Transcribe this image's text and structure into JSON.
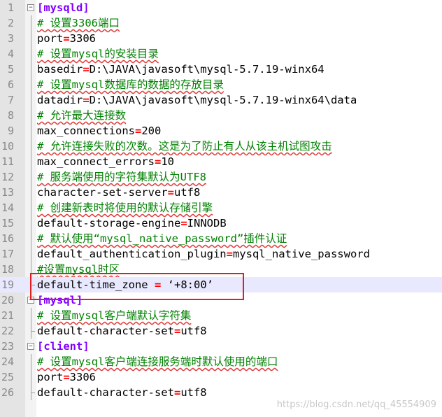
{
  "lines": [
    {
      "num": "1",
      "type": "section",
      "text": "[mysqld]",
      "fold": "open"
    },
    {
      "num": "2",
      "type": "comment",
      "text": "# 设置3306端口"
    },
    {
      "num": "3",
      "type": "kv",
      "key": "port",
      "sep": "=",
      "value": "3306"
    },
    {
      "num": "4",
      "type": "comment",
      "text": "# 设置mysql的安装目录"
    },
    {
      "num": "5",
      "type": "kv",
      "key": "basedir",
      "sep": "=",
      "value": "D:\\JAVA\\javasoft\\mysql-5.7.19-winx64"
    },
    {
      "num": "6",
      "type": "comment",
      "text": "# 设置mysql数据库的数据的存放目录"
    },
    {
      "num": "7",
      "type": "kv",
      "key": "datadir",
      "sep": "=",
      "value": "D:\\JAVA\\javasoft\\mysql-5.7.19-winx64\\data"
    },
    {
      "num": "8",
      "type": "comment",
      "text": "# 允许最大连接数"
    },
    {
      "num": "9",
      "type": "kv",
      "key": "max_connections",
      "sep": "=",
      "value": "200"
    },
    {
      "num": "10",
      "type": "comment",
      "text": "# 允许连接失败的次数。这是为了防止有人从该主机试图攻击"
    },
    {
      "num": "11",
      "type": "kv",
      "key": "max_connect_errors",
      "sep": "=",
      "value": "10"
    },
    {
      "num": "12",
      "type": "comment",
      "text": "# 服务端使用的字符集默认为UTF8"
    },
    {
      "num": "13",
      "type": "kv",
      "key": "character-set-server",
      "sep": "=",
      "value": "utf8"
    },
    {
      "num": "14",
      "type": "comment",
      "text": "# 创建新表时将使用的默认存储引擎"
    },
    {
      "num": "15",
      "type": "kv",
      "key": "default-storage-engine",
      "sep": "=",
      "value": "INNODB"
    },
    {
      "num": "16",
      "type": "comment",
      "text": "# 默认使用“mysql_native_password”插件认证"
    },
    {
      "num": "17",
      "type": "kv",
      "key": "default_authentication_plugin",
      "sep": "=",
      "value": "mysql_native_password"
    },
    {
      "num": "18",
      "type": "comment",
      "text": "#设置mysql时区"
    },
    {
      "num": "19",
      "type": "kv",
      "key": "default-time_zone ",
      "sep": "=",
      "value": " ‘+8:00’",
      "current": true,
      "fold": "end"
    },
    {
      "num": "20",
      "type": "section",
      "text": "[mysql]",
      "fold": "open"
    },
    {
      "num": "21",
      "type": "comment",
      "text": "# 设置mysql客户端默认字符集"
    },
    {
      "num": "22",
      "type": "kv",
      "key": "default-character-set",
      "sep": "=",
      "value": "utf8",
      "fold": "end"
    },
    {
      "num": "23",
      "type": "section",
      "text": "[client]",
      "fold": "open"
    },
    {
      "num": "24",
      "type": "comment",
      "text": "# 设置mysql客户端连接服务端时默认使用的端口"
    },
    {
      "num": "25",
      "type": "kv",
      "key": "port",
      "sep": "=",
      "value": "3306"
    },
    {
      "num": "26",
      "type": "kv",
      "key": "default-character-set",
      "sep": "=",
      "value": "utf8",
      "fold": "end"
    }
  ],
  "watermark": "https://blog.csdn.net/qq_45554909",
  "colors": {
    "section": "#8000ff",
    "comment": "#008000",
    "operator": "#ff0000",
    "highlight_box": "#e02020",
    "current_line": "#e8e8ff"
  }
}
